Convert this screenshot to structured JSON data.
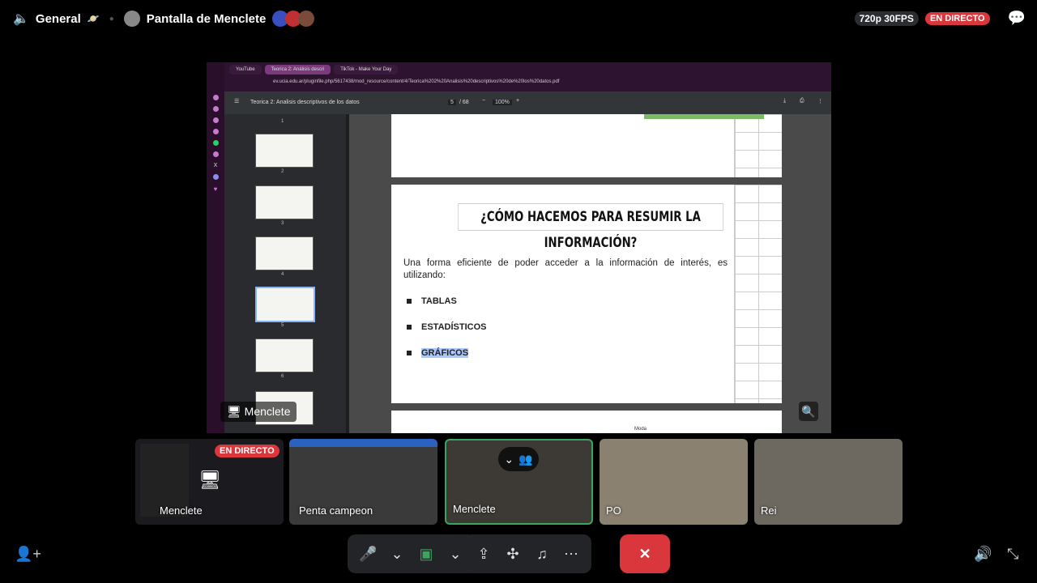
{
  "header": {
    "channel": "General",
    "stream_title": "Pantalla de Menclete",
    "quality": "720p 30FPS",
    "live": "EN DIRECTO"
  },
  "browser": {
    "tabs": [
      "YouTube",
      "Teorica 2: Análisis descri",
      "TikTok - Make Your Day"
    ],
    "url": "ev.ucia.edu.ar/pluginfile.php/5617438/mod_resource/content/4/Teorica%202%20Analisis%20descriptivos%20de%20los%20datos.pdf"
  },
  "pdf": {
    "title": "Teorica 2: Analisis descriptivos de los datos",
    "page": "5",
    "page_total": "/ 68",
    "zoom": "100%",
    "thumb_numbers": [
      "1",
      "2",
      "3",
      "4",
      "5",
      "6"
    ]
  },
  "slide": {
    "title": "¿CÓMO HACEMOS PARA RESUMIR LA INFORMACIÓN?",
    "intro": "Una forma eficiente de poder acceder a la información de interés, es utilizando:",
    "bullets": [
      "TABLAS",
      "ESTADÍSTICOS",
      "GRÁFICOS"
    ],
    "next_page_hint": "Moda"
  },
  "stage": {
    "presenter": "Menclete"
  },
  "participants": [
    {
      "name": "Menclete",
      "badge": "EN DIRECTO"
    },
    {
      "name": "Penta campeon"
    },
    {
      "name": "Menclete"
    },
    {
      "name": "PO"
    },
    {
      "name": "Rei"
    }
  ],
  "icons": {
    "volume": "speaker-icon",
    "chat": "chat-bubble-icon",
    "add_user": "add-user-icon",
    "mic": "microphone-icon",
    "camera": "camera-icon",
    "share": "screen-share-icon",
    "activities": "activities-icon",
    "soundboard": "soundboard-icon",
    "more": "more-icon",
    "end": "end-call-icon",
    "fullscreen": "exit-fullscreen-icon"
  },
  "colors": {
    "live": "#da373c",
    "active_border": "#3ba55d",
    "end_call": "#da373c"
  }
}
